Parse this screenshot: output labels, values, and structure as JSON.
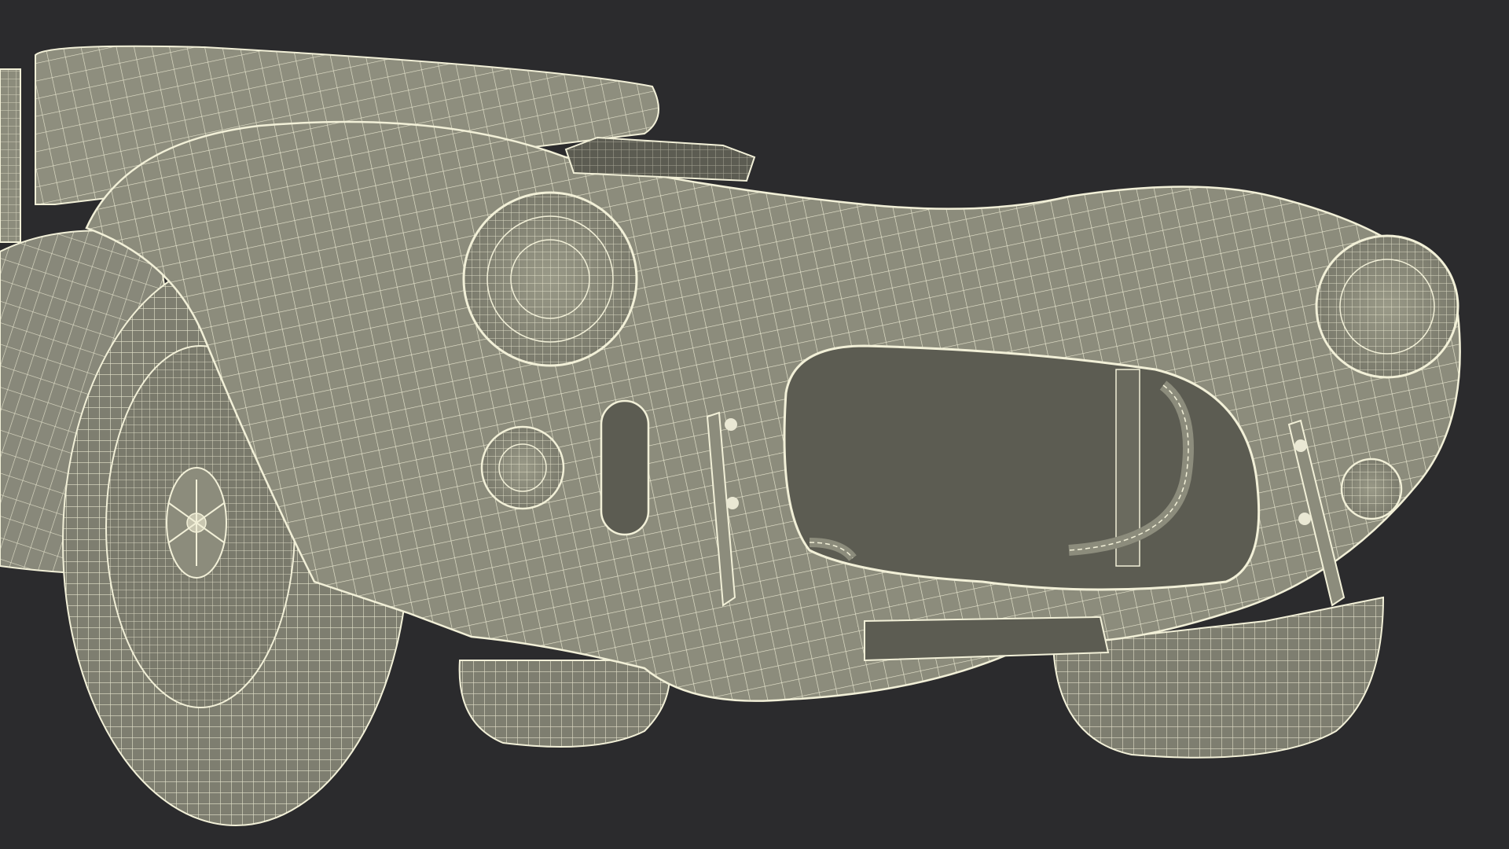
{
  "scene": {
    "background": "#2b2b2d",
    "body_color": "#8c8c7c",
    "body_shadow": "#6e6e62",
    "interior_color": "#5c5c52",
    "wire_color": "#f2f0d8",
    "tire_color": "#7e7e70"
  }
}
